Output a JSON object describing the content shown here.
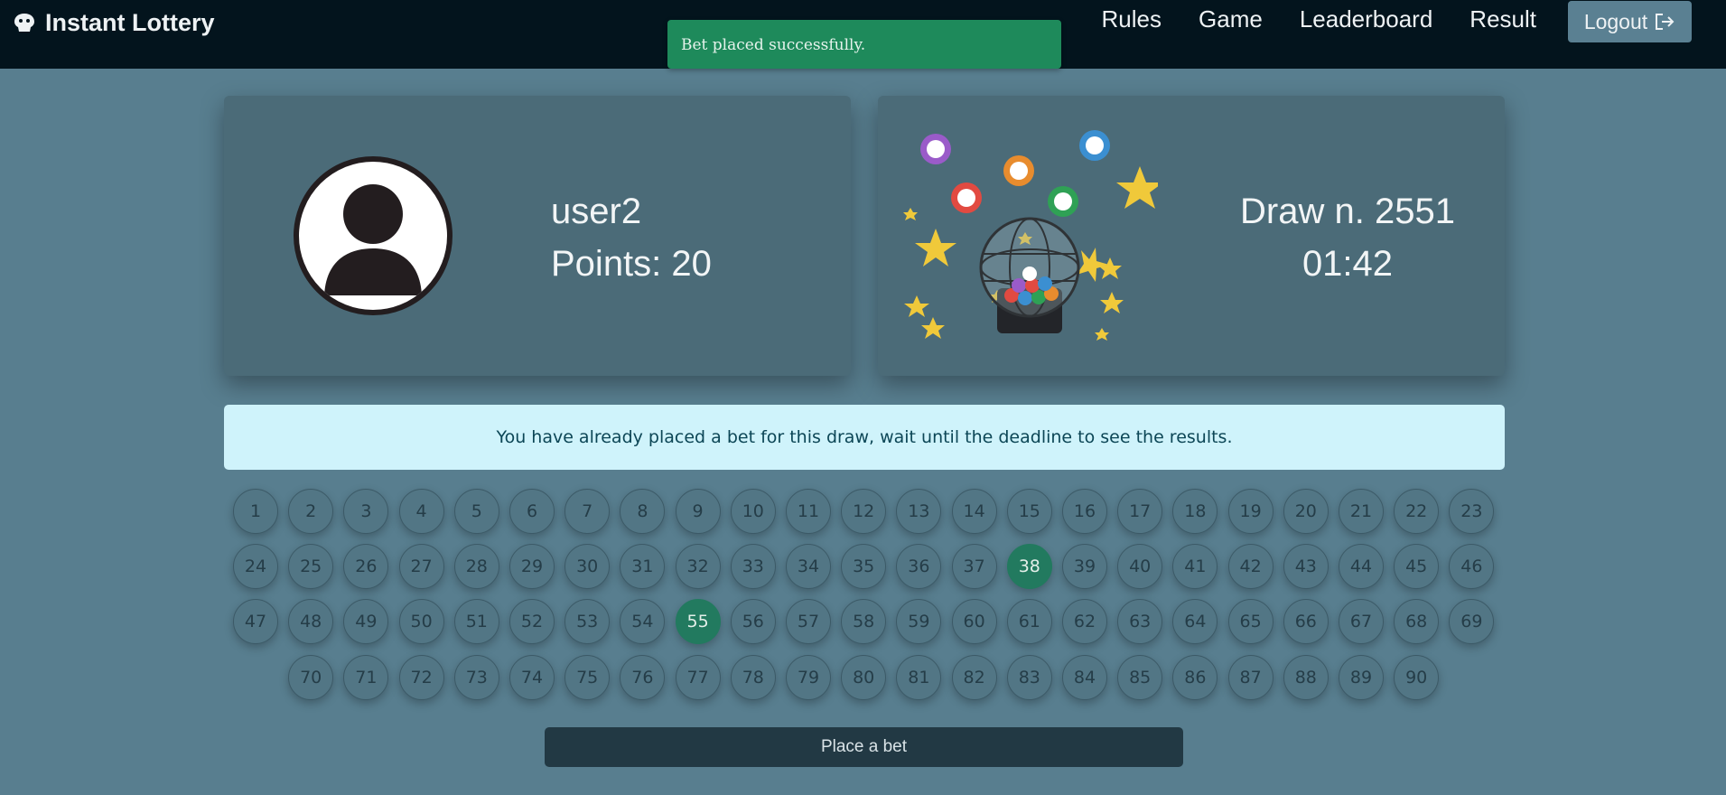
{
  "navbar": {
    "brand": "Instant Lottery",
    "links": [
      "Rules",
      "Game",
      "Leaderboard",
      "Result"
    ],
    "logout_label": "Logout"
  },
  "toast": {
    "message": "Bet placed successfully."
  },
  "user_card": {
    "username": "user2",
    "points_label": "Points: 20"
  },
  "draw_card": {
    "draw_label": "Draw n. 2551",
    "timer": "01:42"
  },
  "alert": {
    "message": "You have already placed a bet for this draw, wait until the deadline to see the results."
  },
  "board": {
    "numbers_from": 1,
    "numbers_to": 90,
    "selected": [
      38,
      55
    ]
  },
  "bet_button": {
    "label": "Place a bet"
  },
  "colors": {
    "accent": "#227a5f",
    "toast": "#1e8a5b",
    "navbar": "#03141d",
    "background": "#587e8f"
  }
}
